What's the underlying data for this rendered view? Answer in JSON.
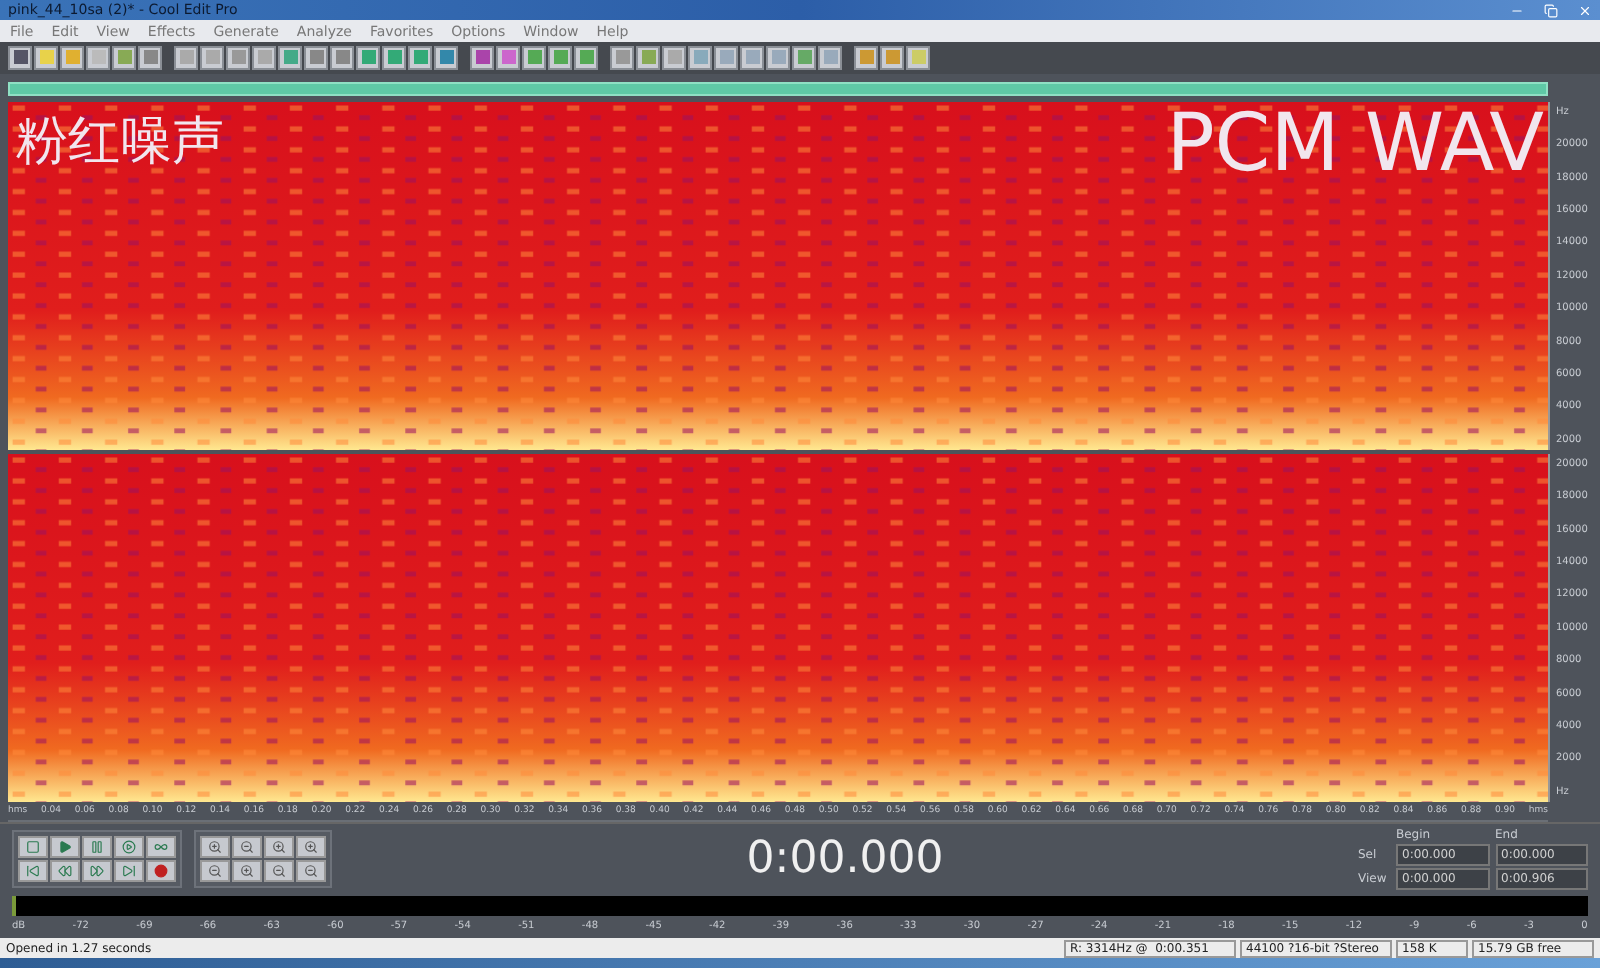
{
  "window": {
    "title": "pink_44_10sa (2)* - Cool Edit Pro"
  },
  "menu": [
    "File",
    "Edit",
    "View",
    "Effects",
    "Generate",
    "Analyze",
    "Favorites",
    "Options",
    "Window",
    "Help"
  ],
  "overlay": {
    "left": "粉红噪声",
    "right": "PCM WAV"
  },
  "channels": [
    {
      "ticks": [
        "Hz",
        "20000",
        "18000",
        "16000",
        "14000",
        "12000",
        "10000",
        "8000",
        "6000",
        "4000",
        "2000"
      ]
    },
    {
      "ticks": [
        "20000",
        "18000",
        "16000",
        "14000",
        "12000",
        "10000",
        "8000",
        "6000",
        "4000",
        "2000",
        "Hz"
      ]
    }
  ],
  "time_ruler": [
    "hms",
    "0.04",
    "0.06",
    "0.08",
    "0.10",
    "0.12",
    "0.14",
    "0.16",
    "0.18",
    "0.20",
    "0.22",
    "0.24",
    "0.26",
    "0.28",
    "0.30",
    "0.32",
    "0.34",
    "0.36",
    "0.38",
    "0.40",
    "0.42",
    "0.44",
    "0.46",
    "0.48",
    "0.50",
    "0.52",
    "0.54",
    "0.56",
    "0.58",
    "0.60",
    "0.62",
    "0.64",
    "0.66",
    "0.68",
    "0.70",
    "0.72",
    "0.74",
    "0.76",
    "0.78",
    "0.80",
    "0.82",
    "0.84",
    "0.86",
    "0.88",
    "0.90",
    "hms"
  ],
  "time_display": "0:00.000",
  "selection": {
    "headers": [
      "Begin",
      "End"
    ],
    "rows": [
      {
        "label": "Sel",
        "begin": "0:00.000",
        "end": "0:00.000"
      },
      {
        "label": "View",
        "begin": "0:00.000",
        "end": "0:00.906"
      }
    ]
  },
  "level_meter": [
    "dB",
    "-72",
    "-69",
    "-66",
    "-63",
    "-60",
    "-57",
    "-54",
    "-51",
    "-48",
    "-45",
    "-42",
    "-39",
    "-36",
    "-33",
    "-30",
    "-27",
    "-24",
    "-21",
    "-18",
    "-15",
    "-12",
    "-9",
    "-6",
    "-3",
    "0"
  ],
  "status_bar": {
    "message": "Opened in 1.27 seconds",
    "cursor": "R: 3314Hz @  0:00.351",
    "format": "44100 ?16-bit ?Stereo",
    "size": "158 K",
    "free": "15.79 GB free"
  }
}
